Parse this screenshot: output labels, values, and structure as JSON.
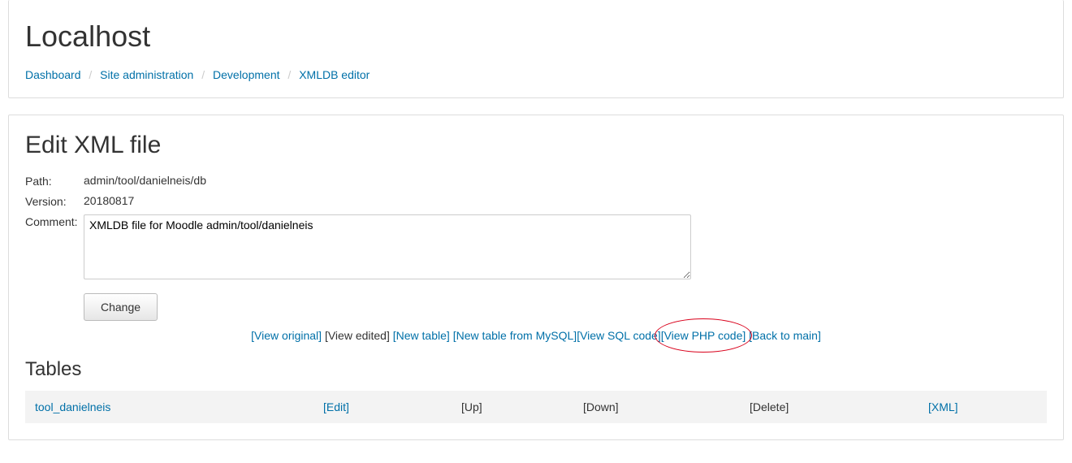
{
  "header": {
    "title": "Localhost",
    "breadcrumb": [
      {
        "label": "Dashboard",
        "link": true
      },
      {
        "label": "Site administration",
        "link": true
      },
      {
        "label": "Development",
        "link": true
      },
      {
        "label": "XMLDB editor",
        "link": true
      }
    ]
  },
  "main": {
    "title": "Edit XML file",
    "fields": {
      "path": {
        "label": "Path:",
        "value": "admin/tool/danielneis/db"
      },
      "version": {
        "label": "Version:",
        "value": "20180817"
      },
      "comment": {
        "label": "Comment:",
        "value": "XMLDB file for Moodle admin/tool/danielneis"
      }
    },
    "change_button": "Change",
    "actions": [
      {
        "key": "view-original",
        "label": "[View original]",
        "enabled": true
      },
      {
        "key": "view-edited",
        "label": "[View edited]",
        "enabled": false
      },
      {
        "key": "new-table",
        "label": "[New table]",
        "enabled": true
      },
      {
        "key": "new-table-mysql",
        "label": "[New table from MySQL]",
        "enabled": true
      },
      {
        "key": "view-sql",
        "label": "[View SQL code]",
        "enabled": true
      },
      {
        "key": "view-php",
        "label": "[View PHP code]",
        "enabled": true,
        "highlighted": true
      },
      {
        "key": "back-main",
        "label": "[Back to main]",
        "enabled": true
      }
    ],
    "tables_heading": "Tables",
    "table_row": {
      "name": "tool_danielneis",
      "edit": "[Edit]",
      "up": "[Up]",
      "down": "[Down]",
      "delete": "[Delete]",
      "xml": "[XML]"
    }
  }
}
